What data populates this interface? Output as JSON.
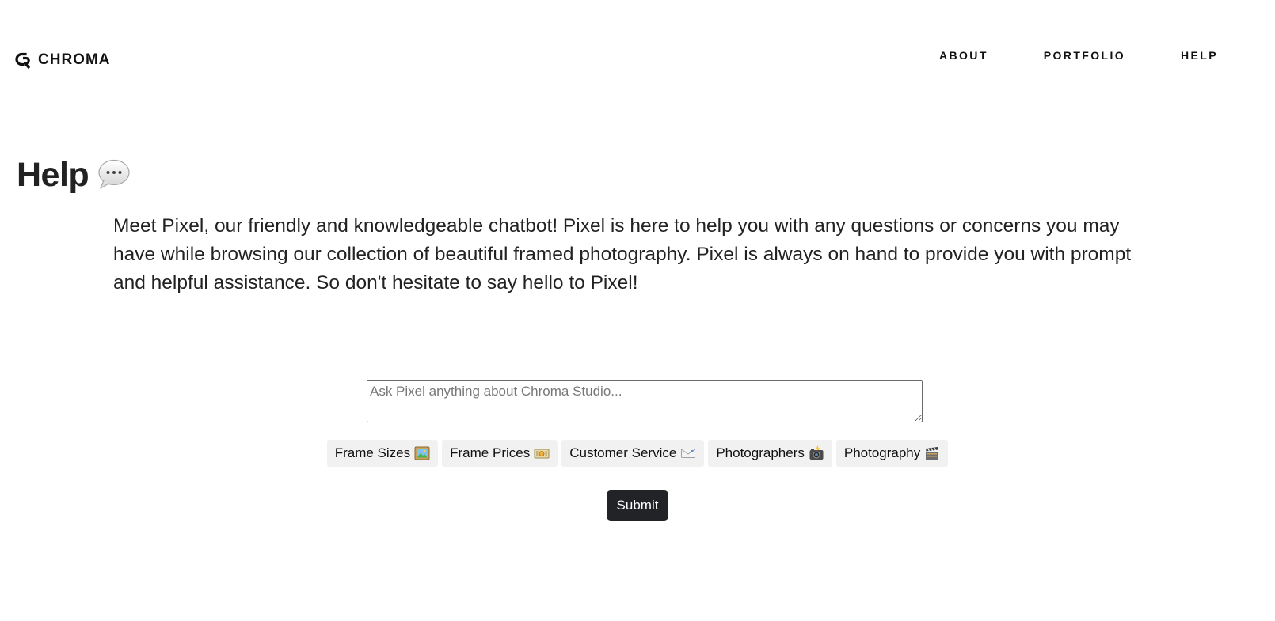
{
  "header": {
    "logo_text": "CHROMA",
    "nav": [
      {
        "label": "ABOUT"
      },
      {
        "label": "PORTFOLIO"
      },
      {
        "label": "HELP"
      }
    ]
  },
  "main": {
    "title": "Help",
    "title_icon": "speech-bubble-icon",
    "intro": "Meet Pixel, our friendly and knowledgeable chatbot! Pixel is here to help you with any questions or concerns you may have while browsing our collection of beautiful framed photography. Pixel is always on hand to provide you with prompt and helpful assistance. So don't hesitate to say hello to Pixel!"
  },
  "chat": {
    "input_value": "",
    "input_placeholder": "Ask Pixel anything about Chroma Studio...",
    "suggestions": [
      {
        "label": "Frame Sizes",
        "icon": "framed-picture-icon"
      },
      {
        "label": "Frame Prices",
        "icon": "money-icon"
      },
      {
        "label": "Customer Service",
        "icon": "envelope-icon"
      },
      {
        "label": "Photographers",
        "icon": "camera-flash-icon"
      },
      {
        "label": "Photography",
        "icon": "film-clapper-icon"
      }
    ],
    "submit_label": "Submit"
  },
  "colors": {
    "text": "#222222",
    "chip_bg": "#f1f1f1",
    "button_bg": "#212326",
    "button_text": "#ffffff"
  }
}
